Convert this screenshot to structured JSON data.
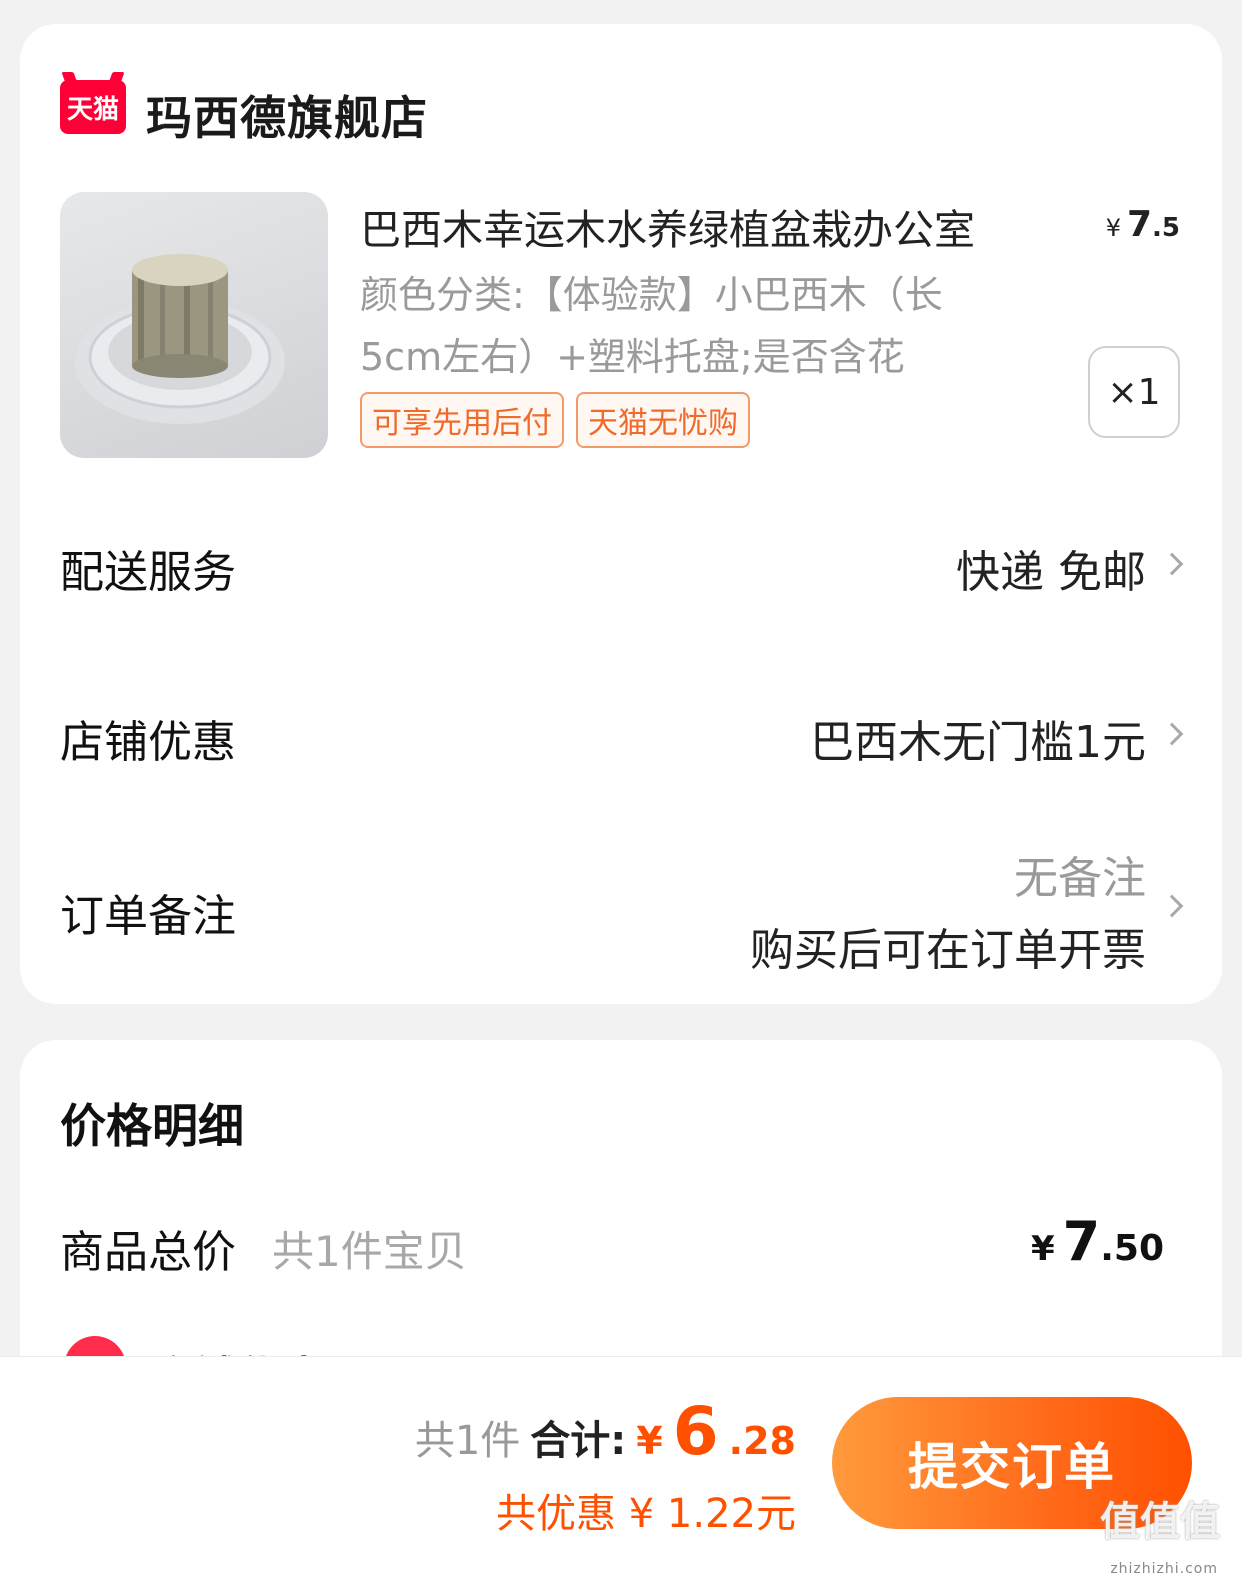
{
  "shop": {
    "logo_text": "天猫",
    "name": "玛西德旗舰店"
  },
  "product": {
    "title": "巴西木幸运木水养绿植盆栽办公室",
    "price_currency": "¥",
    "price_int": "7",
    "price_cents": ".5",
    "spec_line1": "颜色分类:【体验款】小巴西木（长",
    "spec_line2": "5cm左右）+塑料托盘;是否含花",
    "tags": [
      "可享先用后付",
      "天猫无忧购"
    ],
    "quantity": "×1"
  },
  "rows": {
    "delivery_label": "配送服务",
    "delivery_value": "快递 免邮",
    "shop_discount_label": "店铺优惠",
    "shop_discount_value": "巴西木无门槛1元",
    "remark_label": "订单备注",
    "remark_value": "无备注",
    "invoice_note": "购买后可在订单开票"
  },
  "price_detail": {
    "title": "价格明细",
    "goods_total_label": "商品总价",
    "goods_total_sub": "共1件宝贝",
    "goods_total_currency": "¥",
    "goods_total_int": "7",
    "goods_total_cents": ".50",
    "partial_discount_label": "店铺优惠"
  },
  "bottom": {
    "count": "共1件",
    "total_label": "合计:",
    "total_currency": "¥",
    "total_int": "6",
    "total_cents": ".28",
    "discount_text": "共优惠 ¥ 1.22元",
    "submit_label": "提交订单",
    "watermark": "值值值",
    "watermark_url": "zhizhizhi.com"
  },
  "colors": {
    "accent": "#ff5000",
    "tmall_red": "#ff0036",
    "tag_border": "#f39a6b"
  }
}
